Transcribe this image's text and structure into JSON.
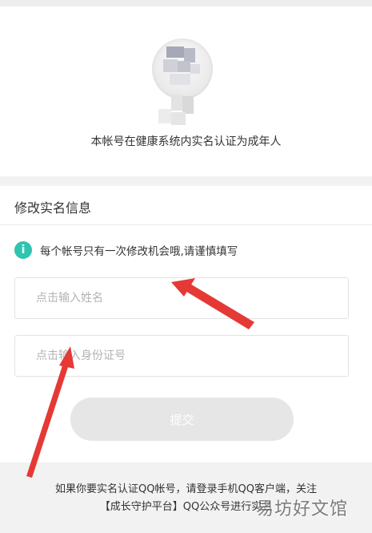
{
  "status_card": {
    "message": "本帐号在健康系统内实名认证为成年人"
  },
  "form": {
    "section_title": "修改实名信息",
    "notice_icon": "i",
    "notice_text": "每个帐号只有一次修改机会哦,请谨慎填写",
    "name_placeholder": "点击输入姓名",
    "id_placeholder": "点击输入身份证号",
    "submit_label": "提交"
  },
  "footer": {
    "line1": "如果你要实名认证QQ帐号，请登录手机QQ客户端，关注",
    "line2": "【成长守护平台】QQ公众号进行实名"
  },
  "watermark": "易坊好文馆",
  "colors": {
    "accent": "#2ec4b0",
    "arrow": "#e53935",
    "button_disabled": "#e6e6e6"
  }
}
